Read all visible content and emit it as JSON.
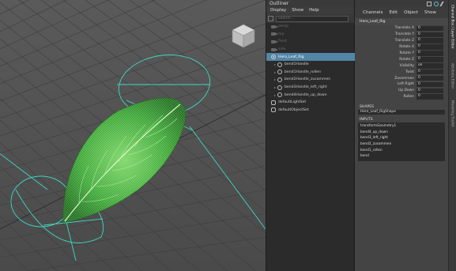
{
  "outliner": {
    "title": "Outliner",
    "menu": [
      "Display",
      "Show",
      "Help"
    ],
    "search_placeholder": "Search...",
    "items": [
      {
        "label": "persp",
        "icon": "camera-icon",
        "dim": true
      },
      {
        "label": "top",
        "icon": "camera-icon",
        "dim": true
      },
      {
        "label": "front",
        "icon": "camera-icon",
        "dim": true
      },
      {
        "label": "side",
        "icon": "camera-icon",
        "dim": true
      },
      {
        "label": "Hero_Leaf_Rig",
        "icon": "group-icon",
        "selected": true
      },
      {
        "label": "bend1Handle",
        "icon": "handle-icon"
      },
      {
        "label": "bend1Handle_rollen",
        "icon": "handle-icon"
      },
      {
        "label": "bend2Handle_zusammen",
        "icon": "handle-icon"
      },
      {
        "label": "bend3Handle_left_right",
        "icon": "handle-icon"
      },
      {
        "label": "bend4Handle_up_down",
        "icon": "handle-icon"
      },
      {
        "label": "defaultLightSet",
        "icon": "set-icon"
      },
      {
        "label": "defaultObjectSet",
        "icon": "set-icon"
      }
    ]
  },
  "channel_box": {
    "menu": [
      "Channels",
      "Edit",
      "Object",
      "Show"
    ],
    "object_name": "Hero_Leaf_Rig",
    "attributes": [
      {
        "label": "Translate X",
        "value": "0"
      },
      {
        "label": "Translate Y",
        "value": "0"
      },
      {
        "label": "Translate Z",
        "value": "0"
      },
      {
        "label": "Rotate X",
        "value": "0"
      },
      {
        "label": "Rotate Y",
        "value": "0"
      },
      {
        "label": "Rotate Z",
        "value": "0"
      },
      {
        "label": "Visibility",
        "value": "on"
      },
      {
        "label": "Twist",
        "value": "0"
      },
      {
        "label": "Zusammen",
        "value": "0"
      },
      {
        "label": "Left Right",
        "value": "0"
      },
      {
        "label": "Up Down",
        "value": "0"
      },
      {
        "label": "Rollen",
        "value": "0"
      }
    ],
    "shapes_header": "SHAPES",
    "shape": "Hero_Leaf_RigShape",
    "inputs_header": "INPUTS",
    "inputs": [
      "transformGeometry1",
      "bend4_up_down",
      "bend3_left_right",
      "bend2_zusammen",
      "bend1_rollen",
      "bend"
    ]
  },
  "side_tabs": [
    "Channel Box / Layer Editor",
    "Attribute Editor",
    "Modeling Toolkit"
  ],
  "colors": {
    "selection": "#5285a6",
    "curve": "#3fd6c1",
    "leaf": "#3fa83a",
    "grid_axis": "#3fd6c1"
  }
}
